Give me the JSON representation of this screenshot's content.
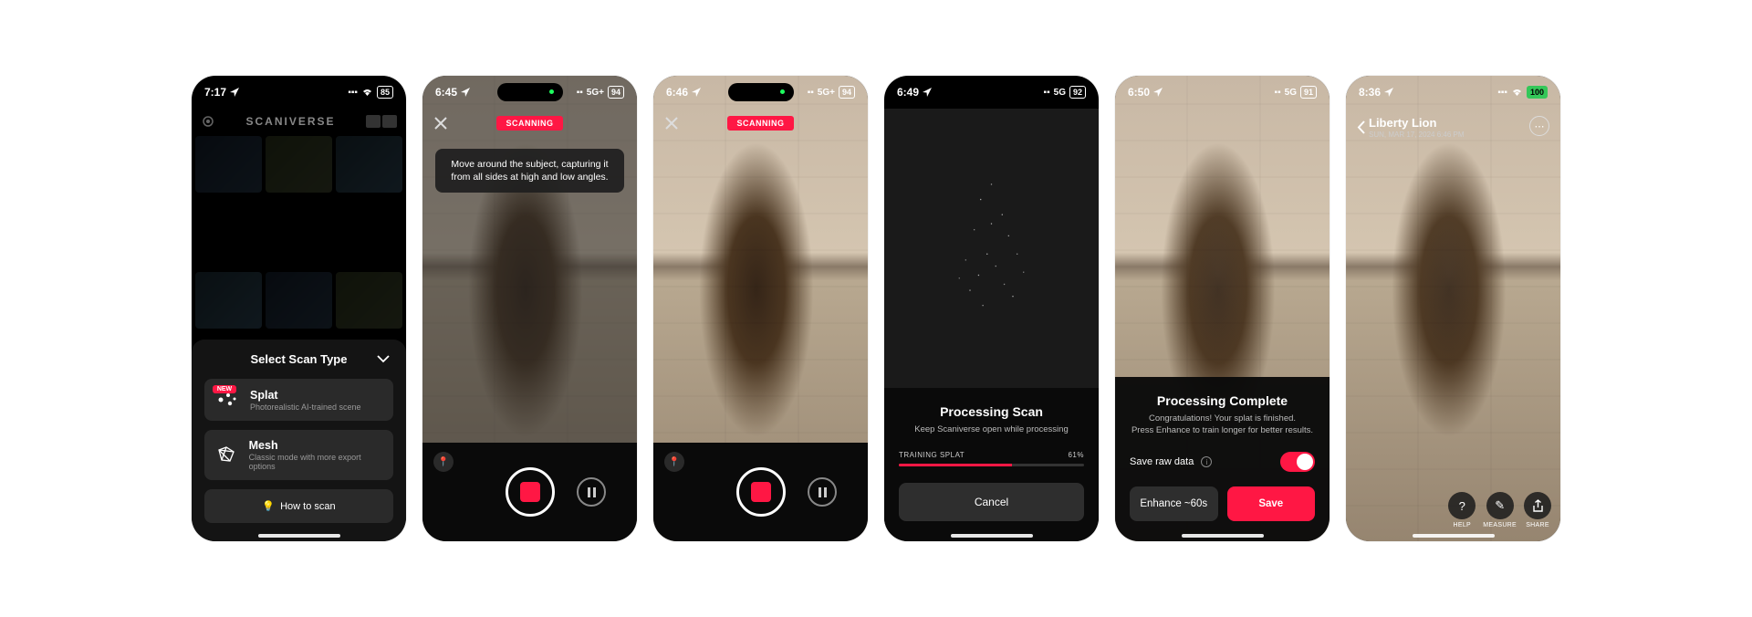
{
  "screens": {
    "s1": {
      "time": "7:17",
      "battery": "85",
      "app_title": "SCANIVERSE",
      "sheet_title": "Select Scan Type",
      "options": [
        {
          "title": "Splat",
          "sub": "Photorealistic AI-trained scene",
          "badge": "NEW"
        },
        {
          "title": "Mesh",
          "sub": "Classic mode with more export options"
        }
      ],
      "howto": "How to scan"
    },
    "s2": {
      "time": "6:45",
      "net": "5G+",
      "battery": "94",
      "badge": "SCANNING",
      "tip": "Move around the subject, capturing it from all sides at high and low angles."
    },
    "s3": {
      "time": "6:46",
      "net": "5G+",
      "battery": "94",
      "badge": "SCANNING"
    },
    "s4": {
      "time": "6:49",
      "net": "5G",
      "battery": "92",
      "title": "Processing Scan",
      "sub": "Keep Scaniverse open while processing",
      "progress_label": "TRAINING SPLAT",
      "progress_pct": "61%",
      "cancel": "Cancel"
    },
    "s5": {
      "time": "6:50",
      "net": "5G",
      "battery": "91",
      "title": "Processing Complete",
      "sub1": "Congratulations! Your splat is finished.",
      "sub2": "Press Enhance to train longer for better results.",
      "raw_label": "Save raw data",
      "enhance": "Enhance ~60s",
      "save": "Save"
    },
    "s6": {
      "time": "8:36",
      "battery": "100",
      "title": "Liberty Lion",
      "subtitle": "SUN, MAR 17, 2024 6:46 PM",
      "tools": {
        "help": "HELP",
        "measure": "MEASURE",
        "share": "SHARE"
      }
    }
  }
}
